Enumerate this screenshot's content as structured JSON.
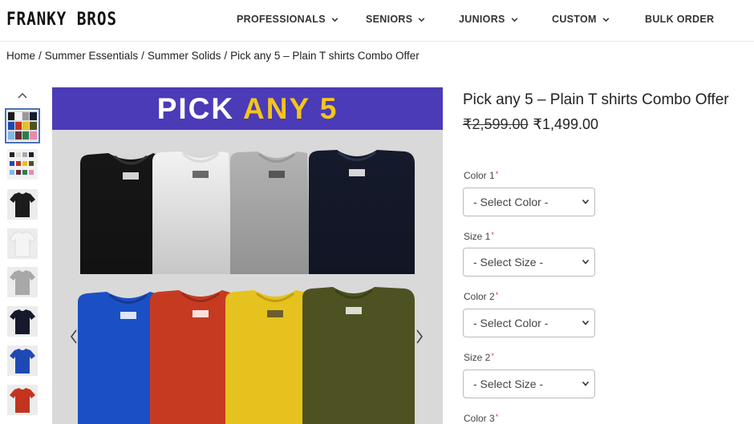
{
  "header": {
    "logo": "FRANKY BROS",
    "nav": [
      {
        "label": "PROFESSIONALS",
        "has_dropdown": true
      },
      {
        "label": "SENIORS",
        "has_dropdown": true
      },
      {
        "label": "JUNIORS",
        "has_dropdown": true
      },
      {
        "label": "CUSTOM",
        "has_dropdown": true
      },
      {
        "label": "BULK ORDER",
        "has_dropdown": false
      }
    ]
  },
  "breadcrumb": [
    "Home",
    "Summer Essentials",
    "Summer Solids",
    "Pick any 5 – Plain T shirts Combo Offer"
  ],
  "gallery": {
    "banner_white": "PICK ",
    "banner_yellow": "ANY 5",
    "thumbnail_colors": [
      "#1c1c1c",
      "#f4f4f4",
      "#a8a8a8",
      "#15192b",
      "#1e49b5",
      "#c2341f"
    ],
    "shirt_colors_top": [
      "#161616",
      "#f2f2f2",
      "#b2b2b2",
      "#151a2c"
    ],
    "shirt_colors_bottom": [
      "#1b4fc4",
      "#c63a22",
      "#e6c21e",
      "#4e5222"
    ]
  },
  "product": {
    "title": "Pick any 5 – Plain T shirts Combo Offer",
    "price_old": "₹2,599.00",
    "price_new": "₹1,499.00",
    "fields": [
      {
        "label": "Color 1",
        "required": "*",
        "value": "- Select Color -"
      },
      {
        "label": "Size 1",
        "required": "*",
        "value": "- Select Size -"
      },
      {
        "label": "Color 2",
        "required": "*",
        "value": "- Select Color -"
      },
      {
        "label": "Size 2",
        "required": "*",
        "value": "- Select Size -"
      },
      {
        "label": "Color 3",
        "required": "*",
        "value": ""
      }
    ]
  },
  "colors": {
    "banner_bg": "#4b3bb7",
    "banner_accent": "#f5c51a",
    "thumb_active_border": "#4a6fb5"
  }
}
